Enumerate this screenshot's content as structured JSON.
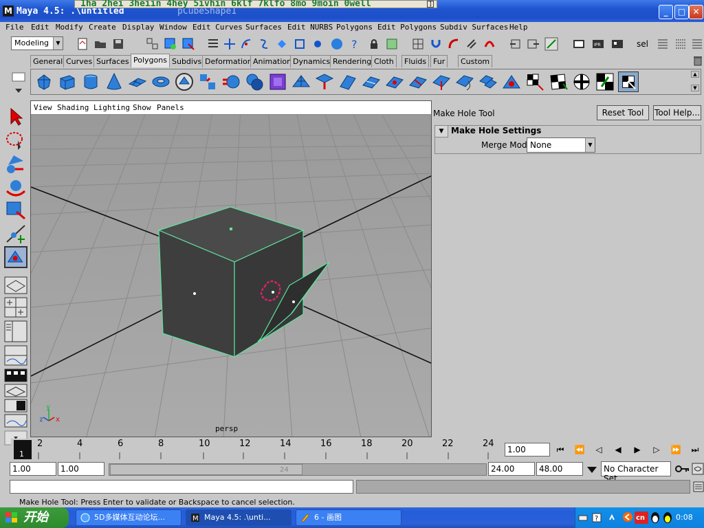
{
  "window": {
    "title": "Maya 4.5: .\\untitled",
    "ghost_title": "pCubeShape1"
  },
  "overlay": {
    "text": "1ha 2hei 3heiin 4hey 5ivhin 6klf 7klfo 8mo 9moin 0well"
  },
  "menu": {
    "items": [
      "File",
      "Edit",
      "Modify",
      "Create",
      "Display",
      "Window",
      "Edit Curves",
      "Surfaces",
      "Edit NURBS",
      "Polygons",
      "Edit Polygons",
      "Subdiv Surfaces",
      "Help"
    ]
  },
  "statusline": {
    "mode": "Modeling",
    "sel_label": "sel"
  },
  "shelf": {
    "tabs": [
      "General",
      "Curves",
      "Surfaces",
      "Polygons",
      "Subdivs",
      "Deformation",
      "Animation",
      "Dynamics",
      "Rendering",
      "Cloth",
      "Fluids",
      "Fur",
      "Custom"
    ],
    "active_tab": "Polygons"
  },
  "viewport": {
    "menu": [
      "View",
      "Shading",
      "Lighting",
      "Show",
      "Panels"
    ],
    "camera": "persp",
    "axis_x": "x",
    "axis_y": "y",
    "axis_z": "z"
  },
  "tool_settings": {
    "tool_name": "Make Hole Tool",
    "reset_label": "Reset Tool",
    "help_label": "Tool Help...",
    "section_title": "Make Hole Settings",
    "merge_label": "Merge Mode",
    "merge_value": "None"
  },
  "timeslider": {
    "current_frame_marker": "1",
    "ticks": [
      "2",
      "4",
      "6",
      "8",
      "10",
      "12",
      "14",
      "16",
      "18",
      "20",
      "22",
      "24"
    ],
    "current_time": "1.00"
  },
  "range": {
    "start": "1.00",
    "playback_start": "1.00",
    "handle_end": "24",
    "playback_end": "24.00",
    "end": "48.00",
    "character_set": "No Character Set"
  },
  "helpline": "Make Hole Tool: Press Enter to validate or Backspace to cancel selection.",
  "taskbar": {
    "start_label": "开始",
    "tasks": [
      "5D多媒体互动论坛...",
      "Maya 4.5: .\\unti...",
      "6 - 画图"
    ],
    "clock": "0:08",
    "tray_cn": "cn"
  },
  "colors": {
    "titlebar": "#1f55d0",
    "ui_gray": "#c8c8c8",
    "viewport_bg": "#a4a4a4",
    "selection_green": "#5fe3a0",
    "cursor_magenta": "#e0206a"
  }
}
